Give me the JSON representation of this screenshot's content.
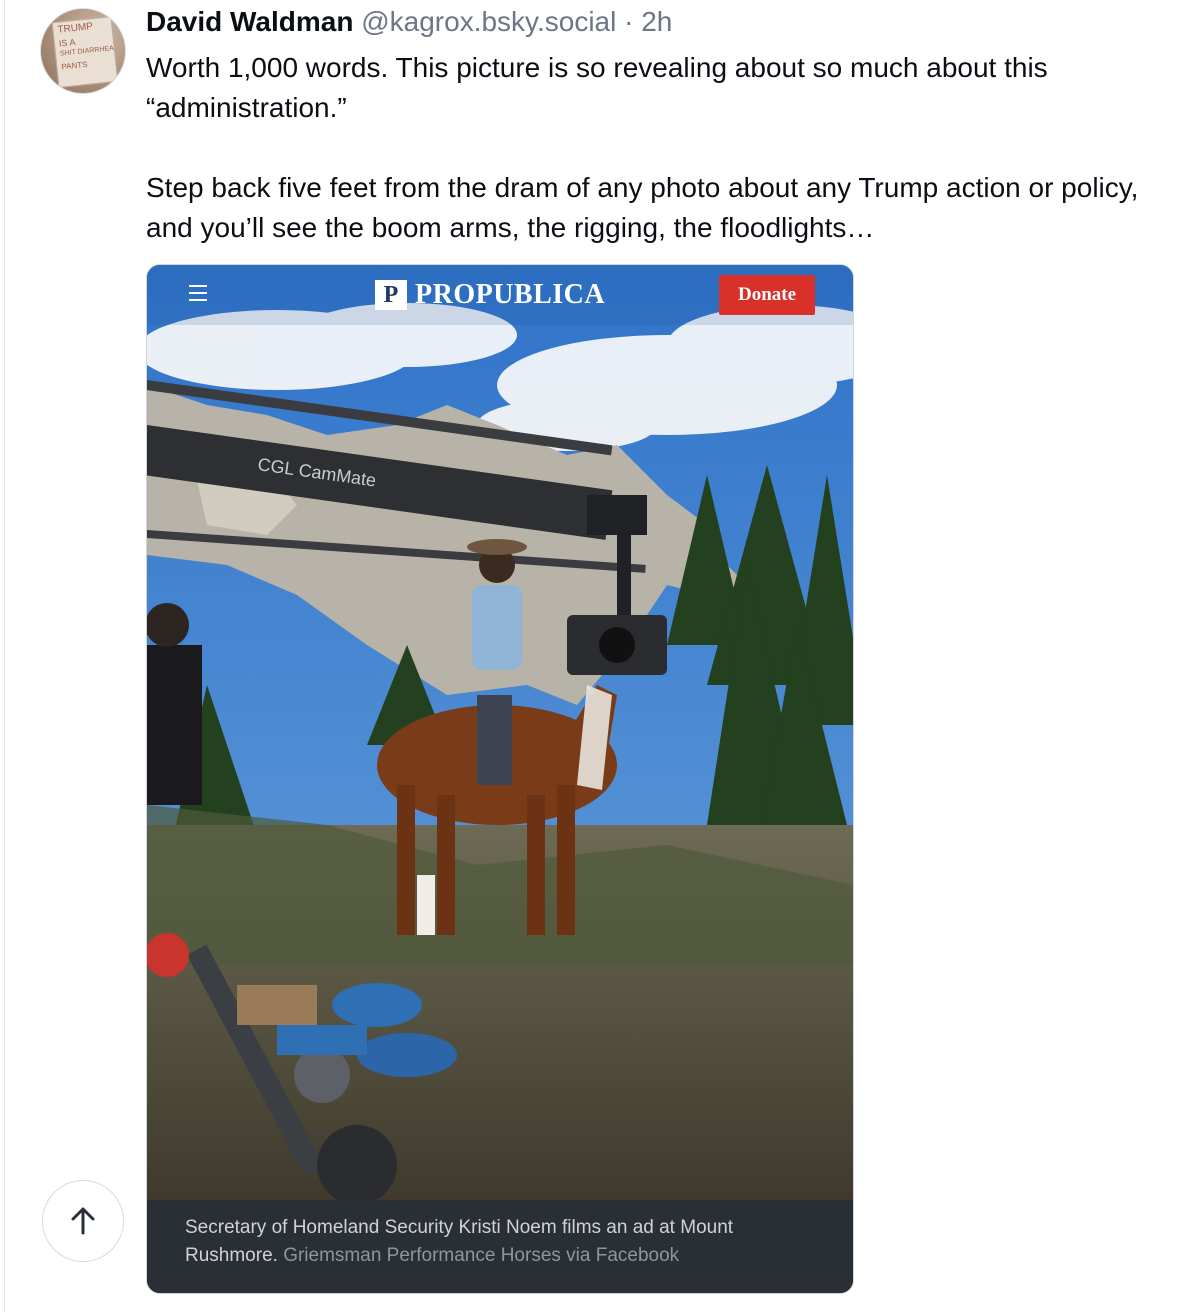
{
  "post": {
    "author_name": "David Waldman",
    "author_handle": "@kagrox.bsky.social",
    "separator": "·",
    "time": "2h",
    "text_p1": "Worth 1,000 words. This picture is so revealing about so much about this “administration.”",
    "text_p2": "Step back five feet from the dram of any photo about any Trump action or policy, and you’ll see the boom arms, the rigging, the floodlights…"
  },
  "avatar": {
    "sign_lines": [
      "TRUMP",
      "IS A",
      "SHIT DIARRHEA",
      "PANTS"
    ]
  },
  "embed": {
    "site_logo_mark": "P",
    "site_name": "PROPUBLICA",
    "donate_label": "Donate",
    "crane_label": "CGL CamMate",
    "caption": "Secretary of Homeland Security Kristi Noem films an ad at Mount Rushmore.",
    "credit": "Griemsman Performance Horses via Facebook"
  },
  "icons": {
    "menu": "hamburger-menu-icon",
    "scroll_top": "arrow-up-icon"
  },
  "colors": {
    "donate": "#d9302a",
    "caption_bg": "#2a2f36",
    "handle": "#6b7785"
  }
}
